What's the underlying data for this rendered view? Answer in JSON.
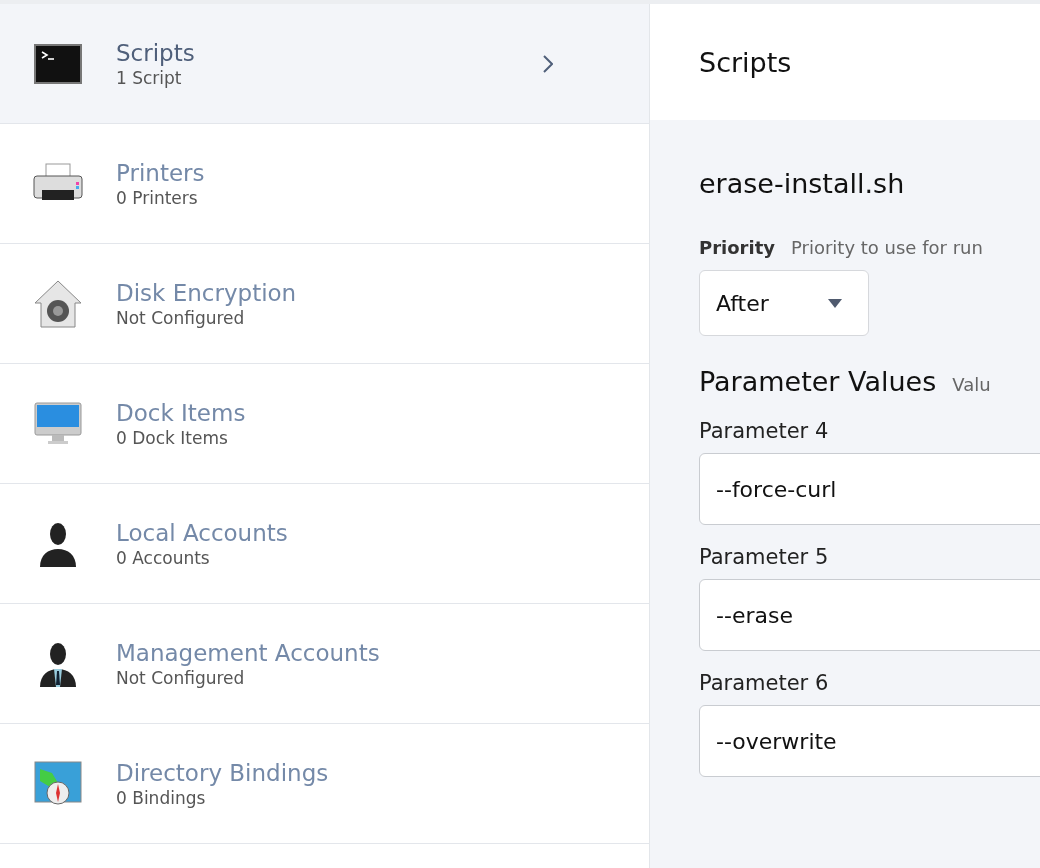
{
  "sidebar": {
    "items": [
      {
        "kind": "terminal",
        "title": "Scripts",
        "subtitle": "1 Script",
        "selected": true
      },
      {
        "kind": "printer",
        "title": "Printers",
        "subtitle": "0 Printers",
        "selected": false
      },
      {
        "kind": "lock",
        "title": "Disk Encryption",
        "subtitle": "Not Configured",
        "selected": false
      },
      {
        "kind": "monitor",
        "title": "Dock Items",
        "subtitle": "0 Dock Items",
        "selected": false
      },
      {
        "kind": "person",
        "title": "Local Accounts",
        "subtitle": "0 Accounts",
        "selected": false
      },
      {
        "kind": "manager",
        "title": "Management Accounts",
        "subtitle": "Not Configured",
        "selected": false
      },
      {
        "kind": "map",
        "title": "Directory Bindings",
        "subtitle": "0 Bindings",
        "selected": false
      }
    ]
  },
  "panel": {
    "title": "Scripts",
    "script_name": "erase-install.sh",
    "priority": {
      "label": "Priority",
      "hint": "Priority to use for run",
      "value": "After"
    },
    "parameters": {
      "title": "Parameter Values",
      "hint": "Valu",
      "fields": [
        {
          "label": "Parameter 4",
          "value": "--force-curl"
        },
        {
          "label": "Parameter 5",
          "value": "--erase"
        },
        {
          "label": "Parameter 6",
          "value": "--overwrite"
        }
      ]
    }
  }
}
